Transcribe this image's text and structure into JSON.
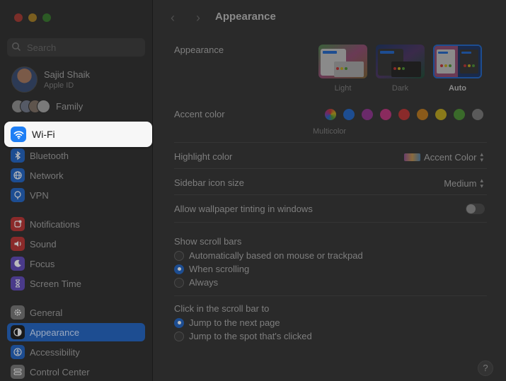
{
  "sidebar": {
    "search_placeholder": "Search",
    "profile": {
      "name": "Sajid Shaik",
      "subtitle": "Apple ID"
    },
    "family_label": "Family",
    "highlighted": {
      "label": "Wi-Fi",
      "icon": "wifi-icon",
      "color": "#1d7ef5"
    },
    "items": [
      {
        "label": "Bluetooth",
        "icon": "bluetooth-icon",
        "color": "#1d4d91"
      },
      {
        "label": "Network",
        "icon": "globe-icon",
        "color": "#1d4d91"
      },
      {
        "label": "VPN",
        "icon": "vpn-icon",
        "color": "#1d4d91"
      },
      {
        "label": "Notifications",
        "icon": "bell-icon",
        "color": "#8a2a2a"
      },
      {
        "label": "Sound",
        "icon": "speaker-icon",
        "color": "#8a2a2a"
      },
      {
        "label": "Focus",
        "icon": "moon-icon",
        "color": "#4a3a8a"
      },
      {
        "label": "Screen Time",
        "icon": "hourglass-icon",
        "color": "#4a3a8a"
      },
      {
        "label": "General",
        "icon": "gear-icon",
        "color": "#5a5a5a"
      },
      {
        "label": "Appearance",
        "icon": "appearance-icon",
        "color": "#1a1a1a",
        "selected": true
      },
      {
        "label": "Accessibility",
        "icon": "accessibility-icon",
        "color": "#1d4d91"
      },
      {
        "label": "Control Center",
        "icon": "control-center-icon",
        "color": "#5a5a5a"
      }
    ]
  },
  "toolbar": {
    "back": "‹",
    "forward": "›",
    "title": "Appearance"
  },
  "appearance": {
    "label": "Appearance",
    "options": [
      {
        "label": "Light",
        "selected": false
      },
      {
        "label": "Dark",
        "selected": false
      },
      {
        "label": "Auto",
        "selected": true
      }
    ]
  },
  "accent": {
    "label": "Accent color",
    "selected_label": "Multicolor",
    "colors": [
      "#multicolor",
      "#1d4d91",
      "#6a2a6a",
      "#8a2a5e",
      "#8a2a2a",
      "#8a5a1a",
      "#8a7a1a",
      "#3a6a2a",
      "#5a5a5a"
    ]
  },
  "highlight": {
    "label": "Highlight color",
    "value": "Accent Color"
  },
  "sidebar_icon_size": {
    "label": "Sidebar icon size",
    "value": "Medium"
  },
  "wallpaper_tinting": {
    "label": "Allow wallpaper tinting in windows",
    "enabled": false
  },
  "scroll_bars": {
    "label": "Show scroll bars",
    "options": [
      {
        "label": "Automatically based on mouse or trackpad",
        "selected": false
      },
      {
        "label": "When scrolling",
        "selected": true
      },
      {
        "label": "Always",
        "selected": false
      }
    ]
  },
  "click_scroll": {
    "label": "Click in the scroll bar to",
    "options": [
      {
        "label": "Jump to the next page",
        "selected": true
      },
      {
        "label": "Jump to the spot that's clicked",
        "selected": false
      }
    ]
  },
  "help": "?"
}
